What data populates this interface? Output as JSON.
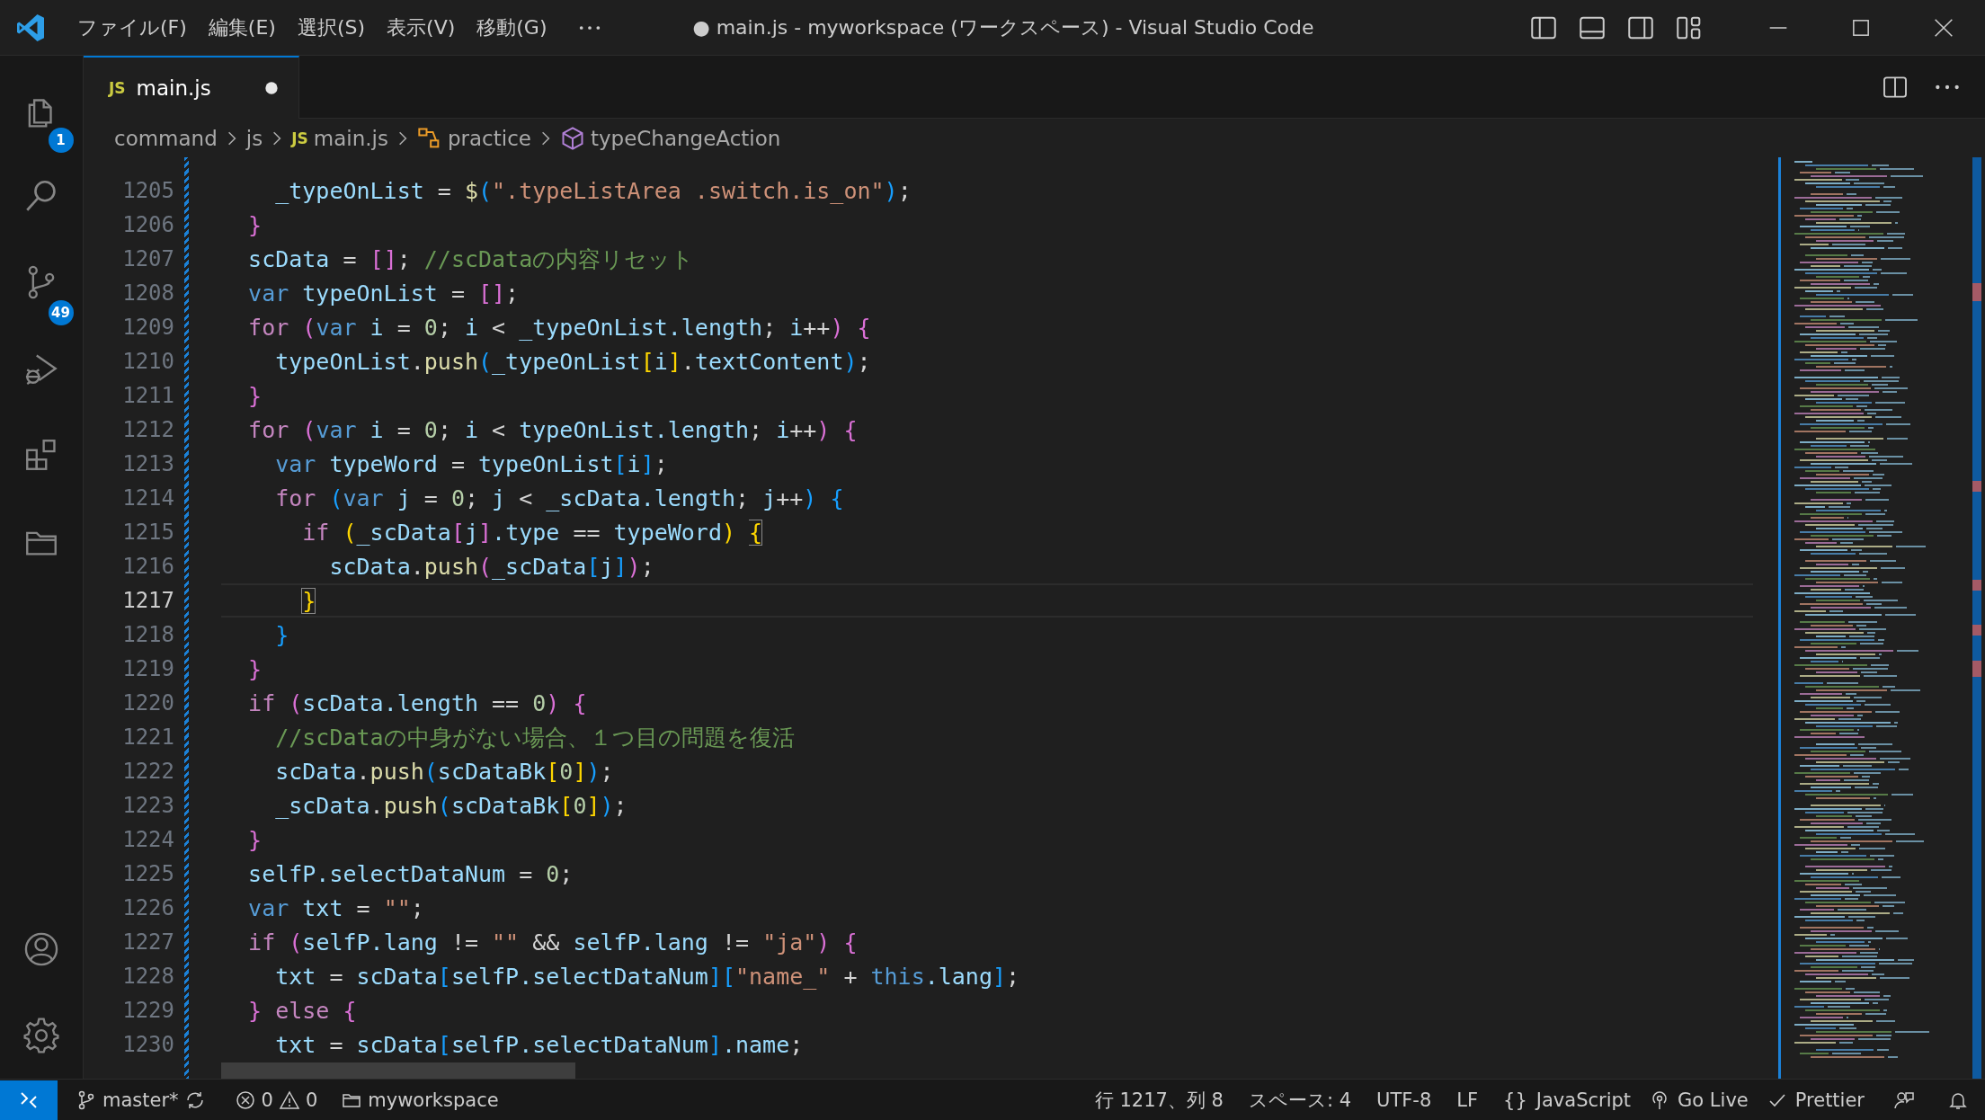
{
  "window": {
    "title": "● main.js - myworkspace (ワークスペース) - Visual Studio Code"
  },
  "menu": [
    "ファイル(F)",
    "編集(E)",
    "選択(S)",
    "表示(V)",
    "移動(G)"
  ],
  "activity_bar": {
    "items": [
      {
        "kind": "explorer",
        "badge": "1"
      },
      {
        "kind": "search"
      },
      {
        "kind": "source-control",
        "badge": "49"
      },
      {
        "kind": "debug"
      },
      {
        "kind": "extensions"
      },
      {
        "kind": "remote"
      }
    ],
    "bottom": [
      {
        "kind": "account"
      },
      {
        "kind": "settings"
      }
    ]
  },
  "tabs": [
    {
      "file_icon": "JS",
      "label": "main.js",
      "selected": true,
      "modified": true
    }
  ],
  "breadcrumb": [
    {
      "kind": "folder",
      "label": "command"
    },
    {
      "kind": "folder",
      "label": "js"
    },
    {
      "kind": "file",
      "icon_text": "JS",
      "label": "main.js"
    },
    {
      "kind": "namespace",
      "label": "practice"
    },
    {
      "kind": "method",
      "label": "typeChangeAction"
    }
  ],
  "editor": {
    "lines": [
      {
        "number": "1205",
        "current": false,
        "tokens": [
          {
            "text": "    _typeOnList",
            "kind": "var"
          },
          {
            "text": " = ",
            "kind": "op"
          },
          {
            "text": "$",
            "kind": "fn"
          },
          {
            "text": "(",
            "kind": "b3"
          },
          {
            "text": "\".typeListArea .switch.is_on\"",
            "kind": "str"
          },
          {
            "text": ")",
            "kind": "b3"
          },
          {
            "text": ";",
            "kind": "op"
          }
        ]
      },
      {
        "number": "1206",
        "current": false,
        "tokens": [
          {
            "text": "  }",
            "kind": "b2"
          }
        ]
      },
      {
        "number": "1207",
        "current": false,
        "tokens": [
          {
            "text": "  scData",
            "kind": "var"
          },
          {
            "text": " = ",
            "kind": "op"
          },
          {
            "text": "[]",
            "kind": "b2"
          },
          {
            "text": "; ",
            "kind": "op"
          },
          {
            "text": "//scDataの内容リセット",
            "kind": "cmt"
          }
        ]
      },
      {
        "number": "1208",
        "current": false,
        "tokens": [
          {
            "text": "  var ",
            "kind": "kw"
          },
          {
            "text": "typeOnList",
            "kind": "var"
          },
          {
            "text": " = ",
            "kind": "op"
          },
          {
            "text": "[]",
            "kind": "b2"
          },
          {
            "text": ";",
            "kind": "op"
          }
        ]
      },
      {
        "number": "1209",
        "current": false,
        "tokens": [
          {
            "text": "  for ",
            "kind": "ctrl"
          },
          {
            "text": "(",
            "kind": "b2"
          },
          {
            "text": "var ",
            "kind": "kw"
          },
          {
            "text": "i",
            "kind": "var"
          },
          {
            "text": " = ",
            "kind": "op"
          },
          {
            "text": "0",
            "kind": "num"
          },
          {
            "text": "; ",
            "kind": "op"
          },
          {
            "text": "i",
            "kind": "var"
          },
          {
            "text": " < ",
            "kind": "op"
          },
          {
            "text": "_typeOnList.length",
            "kind": "var"
          },
          {
            "text": "; ",
            "kind": "op"
          },
          {
            "text": "i",
            "kind": "var"
          },
          {
            "text": "++",
            "kind": "op"
          },
          {
            "text": ")",
            "kind": "b2"
          },
          {
            "text": " {",
            "kind": "b2"
          }
        ]
      },
      {
        "number": "1210",
        "current": false,
        "tokens": [
          {
            "text": "    typeOnList",
            "kind": "var"
          },
          {
            "text": ".",
            "kind": "op"
          },
          {
            "text": "push",
            "kind": "fn"
          },
          {
            "text": "(",
            "kind": "b3"
          },
          {
            "text": "_typeOnList",
            "kind": "var"
          },
          {
            "text": "[",
            "kind": "b1"
          },
          {
            "text": "i",
            "kind": "var"
          },
          {
            "text": "]",
            "kind": "b1"
          },
          {
            "text": ".",
            "kind": "op"
          },
          {
            "text": "textContent",
            "kind": "var"
          },
          {
            "text": ")",
            "kind": "b3"
          },
          {
            "text": ";",
            "kind": "op"
          }
        ]
      },
      {
        "number": "1211",
        "current": false,
        "tokens": [
          {
            "text": "  }",
            "kind": "b2"
          }
        ]
      },
      {
        "number": "1212",
        "current": false,
        "tokens": [
          {
            "text": "  for ",
            "kind": "ctrl"
          },
          {
            "text": "(",
            "kind": "b2"
          },
          {
            "text": "var ",
            "kind": "kw"
          },
          {
            "text": "i",
            "kind": "var"
          },
          {
            "text": " = ",
            "kind": "op"
          },
          {
            "text": "0",
            "kind": "num"
          },
          {
            "text": "; ",
            "kind": "op"
          },
          {
            "text": "i",
            "kind": "var"
          },
          {
            "text": " < ",
            "kind": "op"
          },
          {
            "text": "typeOnList.length",
            "kind": "var"
          },
          {
            "text": "; ",
            "kind": "op"
          },
          {
            "text": "i",
            "kind": "var"
          },
          {
            "text": "++",
            "kind": "op"
          },
          {
            "text": ")",
            "kind": "b2"
          },
          {
            "text": " {",
            "kind": "b2"
          }
        ]
      },
      {
        "number": "1213",
        "current": false,
        "tokens": [
          {
            "text": "    var ",
            "kind": "kw"
          },
          {
            "text": "typeWord",
            "kind": "var"
          },
          {
            "text": " = ",
            "kind": "op"
          },
          {
            "text": "typeOnList",
            "kind": "var"
          },
          {
            "text": "[",
            "kind": "b3"
          },
          {
            "text": "i",
            "kind": "var"
          },
          {
            "text": "]",
            "kind": "b3"
          },
          {
            "text": ";",
            "kind": "op"
          }
        ]
      },
      {
        "number": "1214",
        "current": false,
        "tokens": [
          {
            "text": "    for ",
            "kind": "ctrl"
          },
          {
            "text": "(",
            "kind": "b3"
          },
          {
            "text": "var ",
            "kind": "kw"
          },
          {
            "text": "j",
            "kind": "var"
          },
          {
            "text": " = ",
            "kind": "op"
          },
          {
            "text": "0",
            "kind": "num"
          },
          {
            "text": "; ",
            "kind": "op"
          },
          {
            "text": "j",
            "kind": "var"
          },
          {
            "text": " < ",
            "kind": "op"
          },
          {
            "text": "_scData.length",
            "kind": "var"
          },
          {
            "text": "; ",
            "kind": "op"
          },
          {
            "text": "j",
            "kind": "var"
          },
          {
            "text": "++",
            "kind": "op"
          },
          {
            "text": ")",
            "kind": "b3"
          },
          {
            "text": " {",
            "kind": "b3"
          }
        ]
      },
      {
        "number": "1215",
        "current": false,
        "tokens": [
          {
            "text": "      if ",
            "kind": "ctrl"
          },
          {
            "text": "(",
            "kind": "b1"
          },
          {
            "text": "_scData",
            "kind": "var"
          },
          {
            "text": "[",
            "kind": "b2"
          },
          {
            "text": "j",
            "kind": "var"
          },
          {
            "text": "]",
            "kind": "b2"
          },
          {
            "text": ".type",
            "kind": "var"
          },
          {
            "text": " == ",
            "kind": "op"
          },
          {
            "text": "typeWord",
            "kind": "var"
          },
          {
            "text": ") ",
            "kind": "b1"
          },
          {
            "text": "{",
            "kind": "b1m"
          }
        ]
      },
      {
        "number": "1216",
        "current": false,
        "tokens": [
          {
            "text": "        scData",
            "kind": "var"
          },
          {
            "text": ".",
            "kind": "op"
          },
          {
            "text": "push",
            "kind": "fn"
          },
          {
            "text": "(",
            "kind": "b2"
          },
          {
            "text": "_scData",
            "kind": "var"
          },
          {
            "text": "[",
            "kind": "b3"
          },
          {
            "text": "j",
            "kind": "var"
          },
          {
            "text": "]",
            "kind": "b3"
          },
          {
            "text": ")",
            "kind": "b2"
          },
          {
            "text": ";",
            "kind": "op"
          }
        ]
      },
      {
        "number": "1217",
        "current": true,
        "tokens": [
          {
            "text": "      }",
            "kind": "b1m"
          }
        ]
      },
      {
        "number": "1218",
        "current": false,
        "tokens": [
          {
            "text": "    }",
            "kind": "b3"
          }
        ]
      },
      {
        "number": "1219",
        "current": false,
        "tokens": [
          {
            "text": "  }",
            "kind": "b2"
          }
        ]
      },
      {
        "number": "1220",
        "current": false,
        "tokens": [
          {
            "text": "  if ",
            "kind": "ctrl"
          },
          {
            "text": "(",
            "kind": "b2"
          },
          {
            "text": "scData.length",
            "kind": "var"
          },
          {
            "text": " == ",
            "kind": "op"
          },
          {
            "text": "0",
            "kind": "num"
          },
          {
            "text": ")",
            "kind": "b2"
          },
          {
            "text": " {",
            "kind": "b2"
          }
        ]
      },
      {
        "number": "1221",
        "current": false,
        "tokens": [
          {
            "text": "    //scDataの中身がない場合、１つ目の問題を復活",
            "kind": "cmt"
          }
        ]
      },
      {
        "number": "1222",
        "current": false,
        "tokens": [
          {
            "text": "    scData",
            "kind": "var"
          },
          {
            "text": ".",
            "kind": "op"
          },
          {
            "text": "push",
            "kind": "fn"
          },
          {
            "text": "(",
            "kind": "b3"
          },
          {
            "text": "scDataBk",
            "kind": "var"
          },
          {
            "text": "[",
            "kind": "b1"
          },
          {
            "text": "0",
            "kind": "num"
          },
          {
            "text": "]",
            "kind": "b1"
          },
          {
            "text": ")",
            "kind": "b3"
          },
          {
            "text": ";",
            "kind": "op"
          }
        ]
      },
      {
        "number": "1223",
        "current": false,
        "tokens": [
          {
            "text": "    _scData",
            "kind": "var"
          },
          {
            "text": ".",
            "kind": "op"
          },
          {
            "text": "push",
            "kind": "fn"
          },
          {
            "text": "(",
            "kind": "b3"
          },
          {
            "text": "scDataBk",
            "kind": "var"
          },
          {
            "text": "[",
            "kind": "b1"
          },
          {
            "text": "0",
            "kind": "num"
          },
          {
            "text": "]",
            "kind": "b1"
          },
          {
            "text": ")",
            "kind": "b3"
          },
          {
            "text": ";",
            "kind": "op"
          }
        ]
      },
      {
        "number": "1224",
        "current": false,
        "tokens": [
          {
            "text": "  }",
            "kind": "b2"
          }
        ]
      },
      {
        "number": "1225",
        "current": false,
        "tokens": [
          {
            "text": "  selfP.selectDataNum",
            "kind": "var"
          },
          {
            "text": " = ",
            "kind": "op"
          },
          {
            "text": "0",
            "kind": "num"
          },
          {
            "text": ";",
            "kind": "op"
          }
        ]
      },
      {
        "number": "1226",
        "current": false,
        "tokens": [
          {
            "text": "  var ",
            "kind": "kw"
          },
          {
            "text": "txt",
            "kind": "var"
          },
          {
            "text": " = ",
            "kind": "op"
          },
          {
            "text": "\"\"",
            "kind": "str"
          },
          {
            "text": ";",
            "kind": "op"
          }
        ]
      },
      {
        "number": "1227",
        "current": false,
        "tokens": [
          {
            "text": "  if ",
            "kind": "ctrl"
          },
          {
            "text": "(",
            "kind": "b2"
          },
          {
            "text": "selfP.lang",
            "kind": "var"
          },
          {
            "text": " != ",
            "kind": "op"
          },
          {
            "text": "\"\"",
            "kind": "str"
          },
          {
            "text": " && ",
            "kind": "op"
          },
          {
            "text": "selfP.lang",
            "kind": "var"
          },
          {
            "text": " != ",
            "kind": "op"
          },
          {
            "text": "\"ja\"",
            "kind": "str"
          },
          {
            "text": ")",
            "kind": "b2"
          },
          {
            "text": " {",
            "kind": "b2"
          }
        ]
      },
      {
        "number": "1228",
        "current": false,
        "tokens": [
          {
            "text": "    txt",
            "kind": "var"
          },
          {
            "text": " = ",
            "kind": "op"
          },
          {
            "text": "scData",
            "kind": "var"
          },
          {
            "text": "[",
            "kind": "b3"
          },
          {
            "text": "selfP.selectDataNum",
            "kind": "var"
          },
          {
            "text": "][",
            "kind": "b3"
          },
          {
            "text": "\"name_\"",
            "kind": "str"
          },
          {
            "text": " + ",
            "kind": "op"
          },
          {
            "text": "this",
            "kind": "kw"
          },
          {
            "text": ".lang",
            "kind": "var"
          },
          {
            "text": "]",
            "kind": "b3"
          },
          {
            "text": ";",
            "kind": "op"
          }
        ]
      },
      {
        "number": "1229",
        "current": false,
        "tokens": [
          {
            "text": "  }",
            "kind": "b2"
          },
          {
            "text": " else ",
            "kind": "ctrl"
          },
          {
            "text": "{",
            "kind": "b2"
          }
        ]
      },
      {
        "number": "1230",
        "current": false,
        "tokens": [
          {
            "text": "    txt",
            "kind": "var"
          },
          {
            "text": " = ",
            "kind": "op"
          },
          {
            "text": "scData",
            "kind": "var"
          },
          {
            "text": "[",
            "kind": "b3"
          },
          {
            "text": "selfP.selectDataNum",
            "kind": "var"
          },
          {
            "text": "]",
            "kind": "b3"
          },
          {
            "text": ".name",
            "kind": "var"
          },
          {
            "text": ";",
            "kind": "op"
          }
        ]
      }
    ]
  },
  "status_bar": {
    "branch": "master*",
    "errors": "0",
    "warnings": "0",
    "workspace": "myworkspace",
    "right": [
      {
        "kind": "text",
        "label": "行 1217、列 8"
      },
      {
        "kind": "text",
        "label": "スペース: 4"
      },
      {
        "kind": "text",
        "label": "UTF-8"
      },
      {
        "kind": "text",
        "label": "LF"
      },
      {
        "kind": "language",
        "icon_text": "{}",
        "label": "JavaScript"
      },
      {
        "kind": "live",
        "label": "Go Live"
      },
      {
        "kind": "check",
        "label": "Prettier"
      },
      {
        "kind": "feedback"
      },
      {
        "kind": "bell"
      }
    ]
  }
}
